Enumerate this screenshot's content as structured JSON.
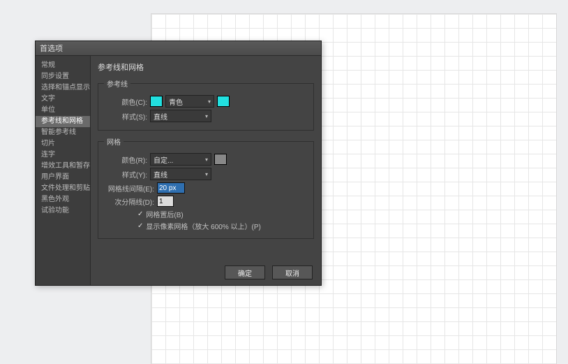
{
  "dialog": {
    "title": "首选项",
    "buttons": {
      "ok": "确定",
      "cancel": "取消"
    }
  },
  "sidebar": {
    "items": [
      "常规",
      "同步设置",
      "选择和锚点显示",
      "文字",
      "单位",
      "参考线和网格",
      "智能参考线",
      "切片",
      "连字",
      "增效工具和暂存盘",
      "用户界面",
      "文件处理和剪贴板",
      "黑色外观",
      "试验功能"
    ],
    "selectedIndex": 5
  },
  "page": {
    "title": "参考线和网格",
    "guides": {
      "legend": "参考线",
      "colorLabel": "颜色(C):",
      "colorValue": "青色",
      "colorSwatch": "#22e0e0",
      "styleLabel": "样式(S):",
      "styleValue": "直线"
    },
    "grid": {
      "legend": "网格",
      "colorLabel": "颜色(R):",
      "colorValue": "自定...",
      "colorSwatch": "#888888",
      "styleLabel": "样式(Y):",
      "styleValue": "直线",
      "spacingLabel": "网格线间隔(E):",
      "spacingValue": "20 px",
      "subdivLabel": "次分隔线(D):",
      "subdivValue": "1",
      "check1": "网格置后(B)",
      "check2": "显示像素网格（放大 600% 以上）(P)"
    }
  }
}
